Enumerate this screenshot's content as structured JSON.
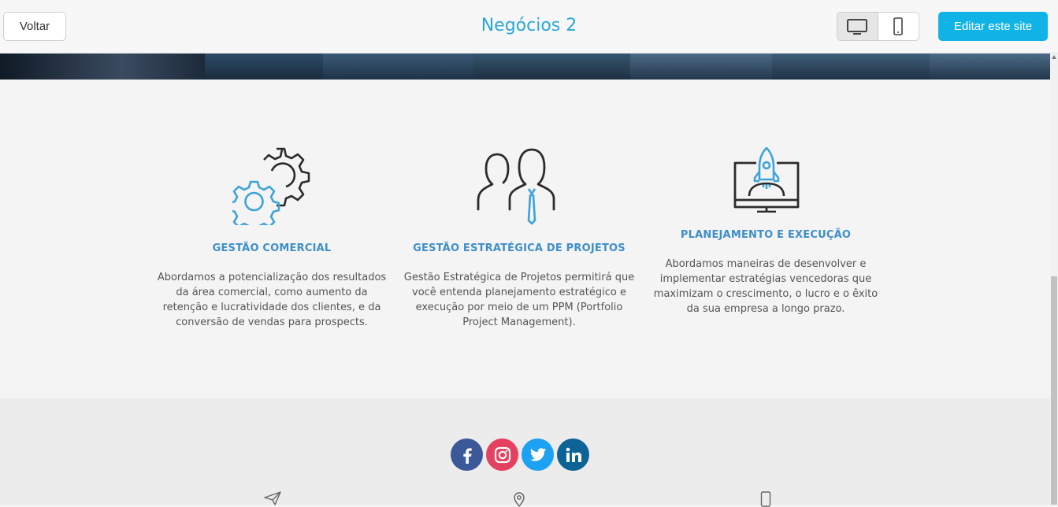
{
  "toolbar": {
    "back_label": "Voltar",
    "site_title": "Negócios 2",
    "edit_label": "Editar este site",
    "device_desktop": "desktop-icon",
    "device_mobile": "mobile-icon"
  },
  "features": [
    {
      "icon": "gears-icon",
      "title": "GESTÃO COMERCIAL",
      "text": "Abordamos a potencialização dos resultados da área comercial, como aumento da retenção e lucratividade dos clientes, e da conversão de vendas para prospects."
    },
    {
      "icon": "business-people-icon",
      "title": "GESTÃO ESTRATÉGICA DE PROJETOS",
      "text": "Gestão Estratégica de Projetos permitirá que você entenda planejamento estratégico e execução por meio de um PPM (Portfolio Project Management)."
    },
    {
      "icon": "rocket-monitor-icon",
      "title": "PLANEJAMENTO E EXECUÇÃO",
      "text": "Abordamos maneiras de desenvolver e implementar estratégias vencedoras que maximizam o crescimento, o lucro e o êxito da sua empresa a longo prazo."
    }
  ],
  "social": [
    {
      "name": "facebook",
      "glyph": "f",
      "color": "#3b5998"
    },
    {
      "name": "instagram",
      "glyph": "◎",
      "color": "#e4405f"
    },
    {
      "name": "twitter",
      "glyph": "t",
      "color": "#1da1f2"
    },
    {
      "name": "linkedin",
      "glyph": "in",
      "color": "#0e6396"
    }
  ],
  "colors": {
    "accent": "#10b3e6",
    "title": "#2aa7d9",
    "feature_heading": "#3e8ec9"
  }
}
